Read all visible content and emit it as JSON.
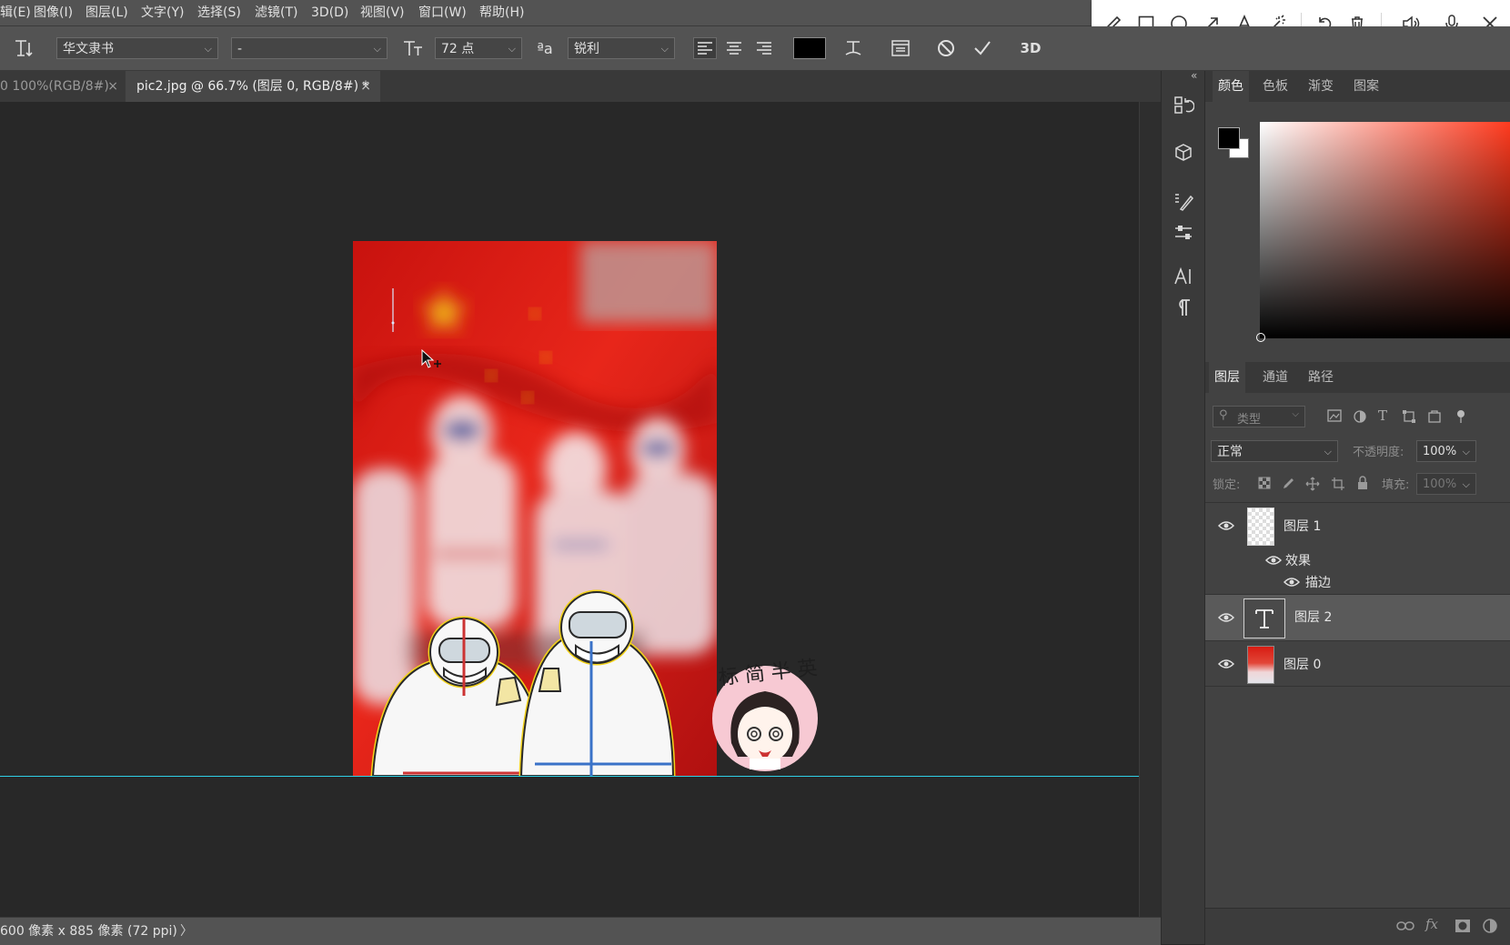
{
  "menu": [
    "辑(E)",
    "图像(I)",
    "图层(L)",
    "文字(Y)",
    "选择(S)",
    "滤镜(T)",
    "3D(D)",
    "视图(V)",
    "窗口(W)",
    "帮助(H)"
  ],
  "options": {
    "font_family": "华文隶书",
    "font_style": "-",
    "font_size": "72 点",
    "aa_label": "ªa",
    "antialias": "锐利",
    "text_color": "#000000",
    "threed_label": "3D"
  },
  "tabs": [
    {
      "label": "0 100%(RGB/8#)"
    },
    {
      "label": "pic2.jpg @ 66.7% (图层 0, RGB/8#) *"
    }
  ],
  "image": {
    "sticker_text": "标 简 半 英"
  },
  "status": {
    "doc_size": "600 像素 x 885 像素 (72 ppi)",
    "arrow": "〉"
  },
  "color_panel": {
    "tabs": [
      "颜色",
      "色板",
      "渐变",
      "图案"
    ],
    "foreground": "#000000",
    "background": "#ffffff",
    "hue": "#ff3a1e"
  },
  "layers_panel": {
    "tabs": [
      "图层",
      "通道",
      "路径"
    ],
    "filter_placeholder": "类型",
    "blend_mode": "正常",
    "opacity_label": "不透明度:",
    "opacity": "100%",
    "lock_label": "锁定:",
    "fill_label": "填充:",
    "fill": "100%",
    "layers": [
      {
        "name": "图层 1",
        "effects_label": "效果",
        "effect": "描边"
      },
      {
        "name": "图层 2"
      },
      {
        "name": "图层 0"
      }
    ]
  }
}
